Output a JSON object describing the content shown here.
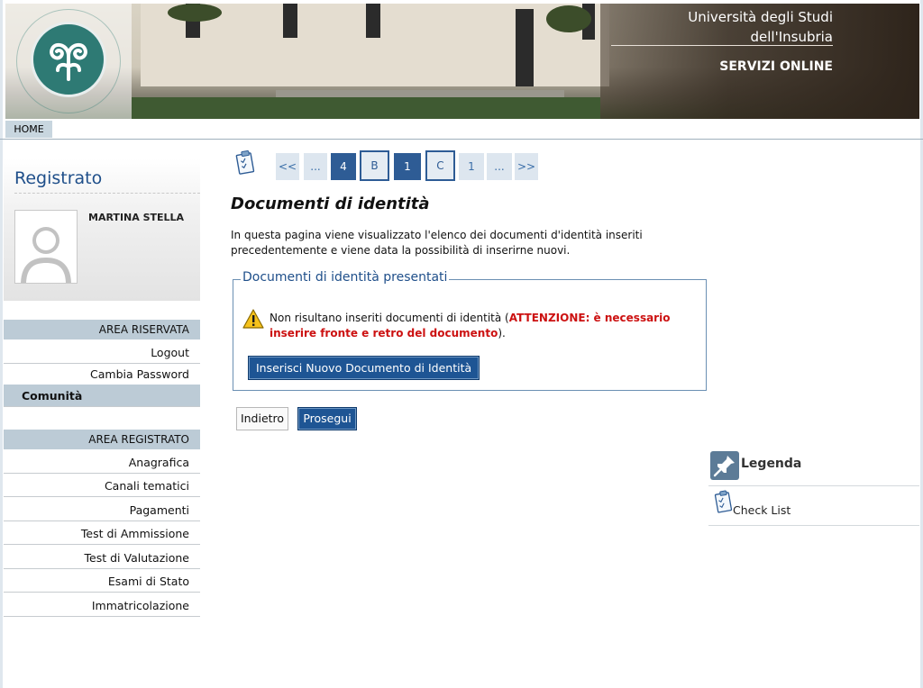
{
  "header": {
    "university_line1": "Università degli Studi",
    "university_line2": "dell'Insubria",
    "services": "SERVIZI ONLINE",
    "logo_icon": "university-seal-icon"
  },
  "topnav": {
    "home": "HOME"
  },
  "sidebar": {
    "title": "Registrato",
    "user_name": "MARTINA STELLA",
    "area_riservata": "AREA RISERVATA",
    "riservata_items": [
      "Logout",
      "Cambia Password"
    ],
    "community": "Comunità",
    "area_registrato": "AREA REGISTRATO",
    "registrato_items": [
      "Anagrafica",
      "Canali tematici",
      "Pagamenti",
      "Test di Ammissione",
      "Test di Valutazione",
      "Esami di Stato",
      "Immatricolazione"
    ]
  },
  "stepper": {
    "icon": "checklist-icon",
    "steps": [
      "<<",
      "...",
      "4",
      "B",
      "1",
      "C",
      "1",
      "...",
      ">>"
    ]
  },
  "main": {
    "title": "Documenti di identità",
    "intro": "In questa pagina viene visualizzato l'elenco dei documenti d'identità inseriti precedentemente e viene data la possibilità di inserirne nuovi.",
    "box_legend": "Documenti di identità presentati",
    "warning_prefix": "Non risultano inseriti documenti di identità (",
    "warning_emphasis": "ATTENZIONE: è necessario inserire fronte e retro del documento",
    "warning_suffix": ").",
    "new_doc_button": "Inserisci Nuovo Documento di Identità",
    "back_button": "Indietro",
    "next_button": "Prosegui"
  },
  "right_panel": {
    "legend": "Legenda",
    "checklist": "Check List",
    "legend_icon": "pushpin-icon",
    "checklist_icon": "checklist-icon"
  },
  "colors": {
    "brand_blue": "#1e5594",
    "title_blue": "#1f4f8a",
    "menu_header": "#bccbd6",
    "warning_red": "#cc1111"
  }
}
